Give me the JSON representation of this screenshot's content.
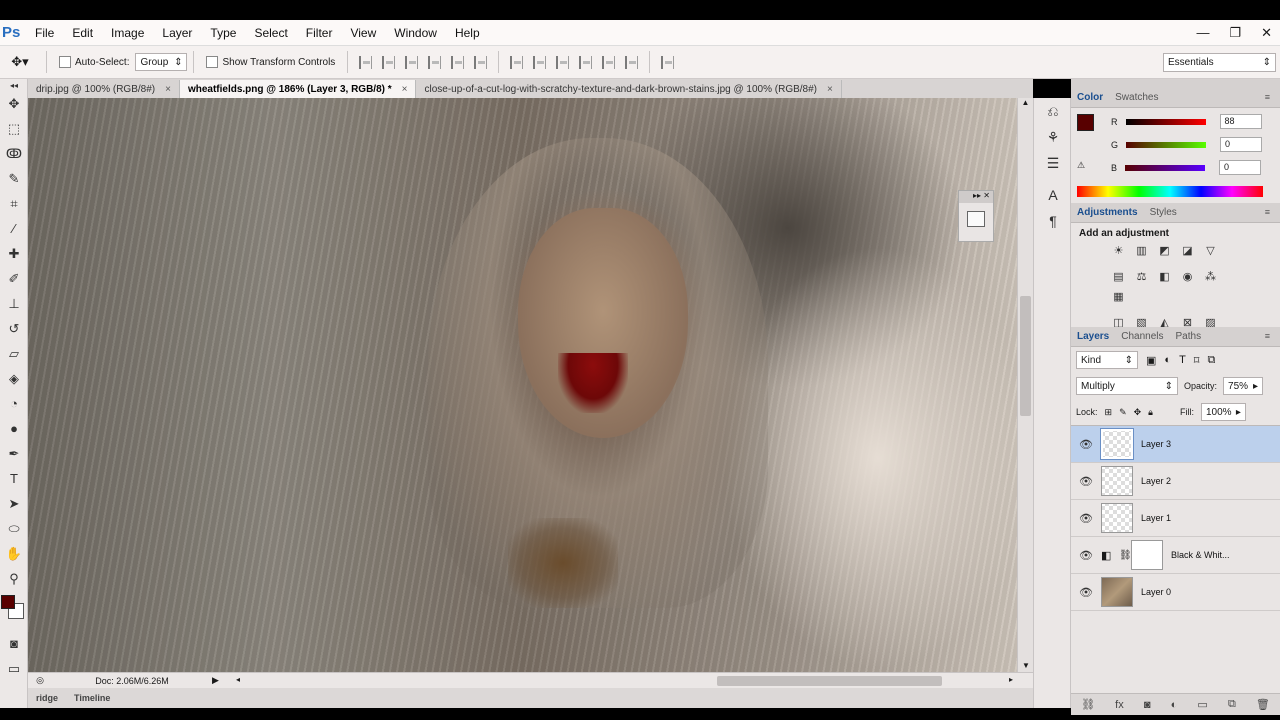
{
  "app": {
    "logo": "Ps"
  },
  "menu": [
    "File",
    "Edit",
    "Image",
    "Layer",
    "Type",
    "Select",
    "Filter",
    "View",
    "Window",
    "Help"
  ],
  "window_controls": {
    "minimize": "—",
    "restore": "❐",
    "close": "✕"
  },
  "options_bar": {
    "auto_select_label": "Auto-Select:",
    "auto_select_value": "Group",
    "transform_label": "Show Transform Controls"
  },
  "workspace": {
    "label": "Essentials"
  },
  "doc_tabs": [
    {
      "label": "drip.jpg @ 100% (RGB/8#)",
      "active": false
    },
    {
      "label": "wheatfields.png @ 186% (Layer 3, RGB/8) *",
      "active": true
    },
    {
      "label": "close-up-of-a-cut-log-with-scratchy-texture-and-dark-brown-stains.jpg @ 100% (RGB/8#)",
      "active": false
    }
  ],
  "tab_close": "×",
  "status": {
    "doc": "Doc: 2.06M/6.26M"
  },
  "bottom_tabs": [
    "ridge",
    "Timeline"
  ],
  "color_panel": {
    "tabs": [
      "Color",
      "Swatches"
    ],
    "r_label": "R",
    "r_value": "88",
    "g_label": "G",
    "g_value": "0",
    "b_label": "B",
    "b_value": "0",
    "foreground": "#580000"
  },
  "adjustments_panel": {
    "tabs": [
      "Adjustments",
      "Styles"
    ],
    "heading": "Add an adjustment"
  },
  "layers_panel": {
    "tabs": [
      "Layers",
      "Channels",
      "Paths"
    ],
    "filter_kind": "Kind",
    "blend_mode": "Multiply",
    "opacity_label": "Opacity:",
    "opacity_value": "75%",
    "lock_label": "Lock:",
    "fill_label": "Fill:",
    "fill_value": "100%",
    "layers": [
      {
        "name": "Layer 3",
        "selected": true
      },
      {
        "name": "Layer 2",
        "selected": false
      },
      {
        "name": "Layer 1",
        "selected": false
      },
      {
        "name": "Black & Whit...",
        "selected": false
      },
      {
        "name": "Layer 0",
        "selected": false
      }
    ]
  },
  "accent_colors": {
    "selection": "#bcd0ec",
    "active_tab": "#1b4f8f",
    "foreground_swatch": "#580000"
  }
}
